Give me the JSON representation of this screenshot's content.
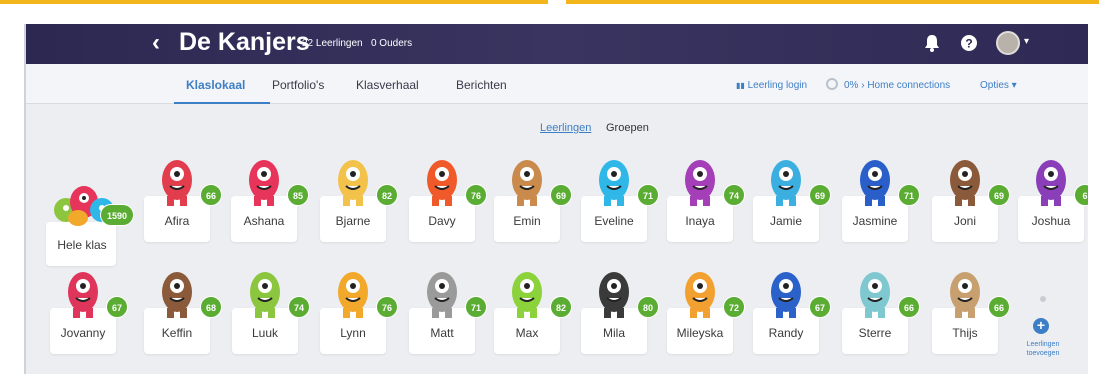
{
  "header": {
    "class_name": "De Kanjers",
    "students_count": "22 Leerlingen",
    "parents_count": "0 Ouders",
    "back_icon": "chevron-left-icon",
    "bell_icon": "bell-icon",
    "help_icon": "help-icon",
    "caret": "▾"
  },
  "tabs": [
    {
      "label": "Klaslokaal"
    },
    {
      "label": "Portfolio's"
    },
    {
      "label": "Klasverhaal"
    },
    {
      "label": "Berichten"
    }
  ],
  "right_nav": {
    "student_login": "Leerling login",
    "home_connections": "0% › Home connections",
    "options": "Opties ▾"
  },
  "view_switch": {
    "students": "Leerlingen",
    "groups": "Groepen"
  },
  "whole_class": {
    "name": "Hele klas",
    "points": "1590"
  },
  "students": [
    {
      "name": "Afira",
      "points": "66",
      "color": "#e23d4c",
      "eye": "#ffffff"
    },
    {
      "name": "Ashana",
      "points": "85",
      "color": "#e6345a",
      "eye": "#ffffff"
    },
    {
      "name": "Bjarne",
      "points": "82",
      "color": "#f2c24a",
      "eye": "#ffffff"
    },
    {
      "name": "Davy",
      "points": "76",
      "color": "#f05a2a",
      "eye": "#ffffff"
    },
    {
      "name": "Emin",
      "points": "69",
      "color": "#c98a4b",
      "eye": "#ffffff"
    },
    {
      "name": "Eveline",
      "points": "71",
      "color": "#2fb7e8",
      "eye": "#ffffff"
    },
    {
      "name": "Inaya",
      "points": "74",
      "color": "#a43fb8",
      "eye": "#ffffff"
    },
    {
      "name": "Jamie",
      "points": "69",
      "color": "#3bb0e0",
      "eye": "#ffffff"
    },
    {
      "name": "Jasmine",
      "points": "71",
      "color": "#2a5fc9",
      "eye": "#ffffff"
    },
    {
      "name": "Joni",
      "points": "69",
      "color": "#8a5a3a",
      "eye": "#ffffff"
    },
    {
      "name": "Joshua",
      "points": "6",
      "color": "#8a3fb8",
      "eye": "#ffffff"
    },
    {
      "name": "Jovanny",
      "points": "67",
      "color": "#e0355a",
      "eye": "#ffffff"
    },
    {
      "name": "Keffin",
      "points": "68",
      "color": "#8a5a3a",
      "eye": "#ffffff"
    },
    {
      "name": "Luuk",
      "points": "74",
      "color": "#8cc63f",
      "eye": "#ffffff"
    },
    {
      "name": "Lynn",
      "points": "76",
      "color": "#f2a82a",
      "eye": "#ffffff"
    },
    {
      "name": "Matt",
      "points": "71",
      "color": "#9a9a9a",
      "eye": "#ffffff"
    },
    {
      "name": "Max",
      "points": "82",
      "color": "#8cd23a",
      "eye": "#ffffff"
    },
    {
      "name": "Mila",
      "points": "80",
      "color": "#3a3a3a",
      "eye": "#ffffff"
    },
    {
      "name": "Mileyska",
      "points": "72",
      "color": "#f2a030",
      "eye": "#ffffff"
    },
    {
      "name": "Randy",
      "points": "67",
      "color": "#2a62c9",
      "eye": "#ffffff"
    },
    {
      "name": "Sterre",
      "points": "66",
      "color": "#7fc8d0",
      "eye": "#ffffff"
    },
    {
      "name": "Thijs",
      "points": "66",
      "color": "#c8a070",
      "eye": "#ffffff"
    }
  ],
  "add_students": {
    "line1": "Leerlingen",
    "line2": "toevoegen",
    "icon": "plus-icon"
  }
}
